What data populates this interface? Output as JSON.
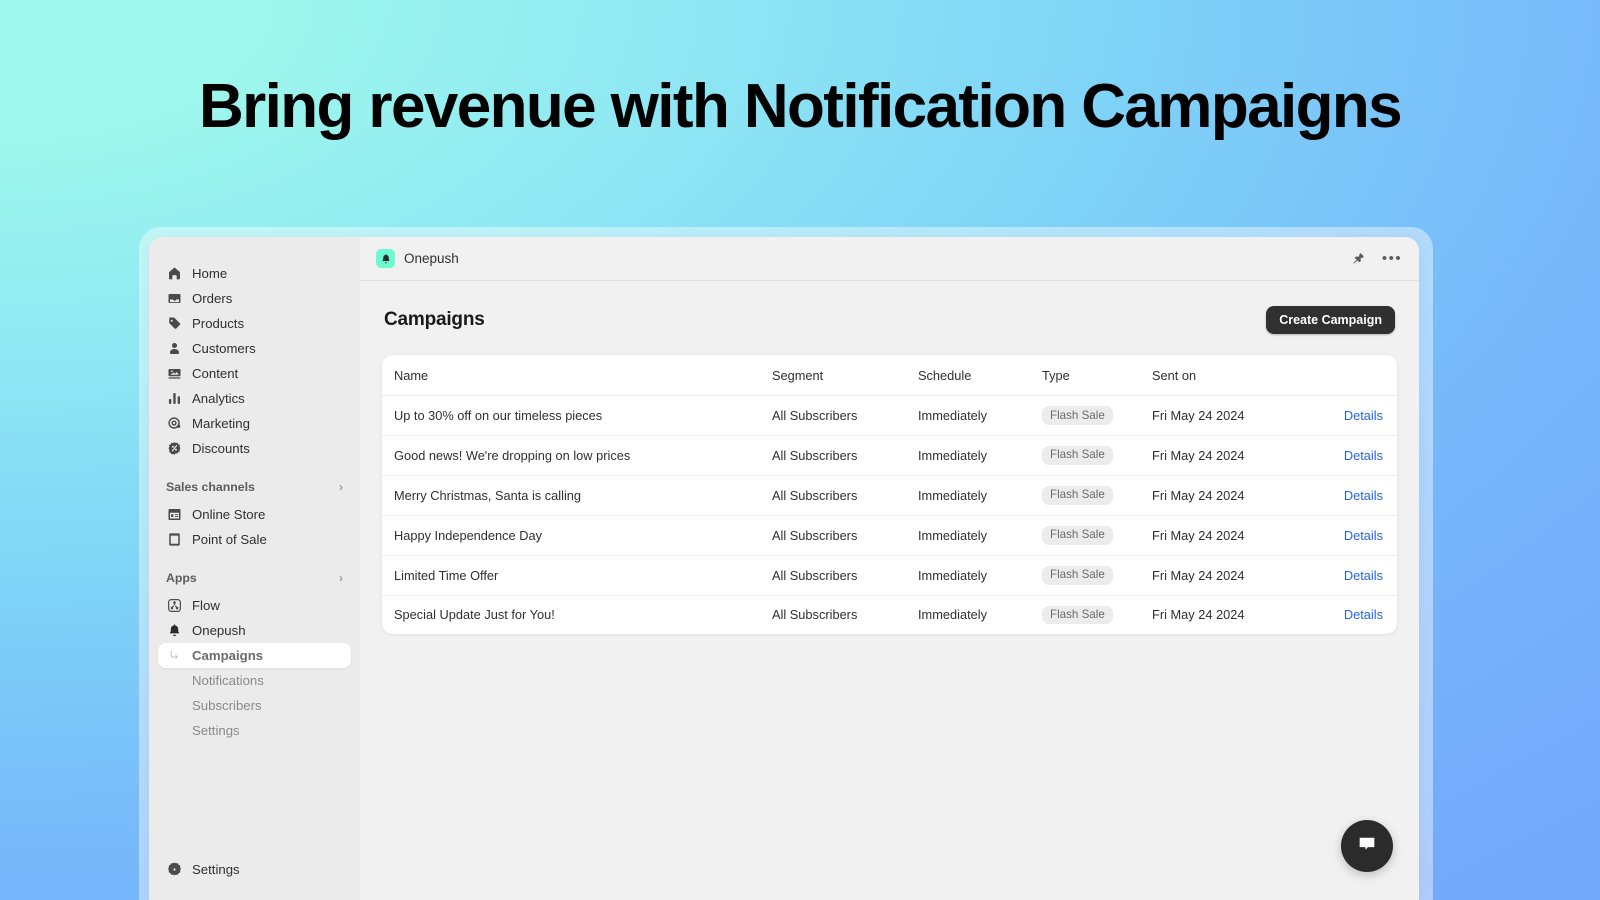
{
  "headline": "Bring revenue with Notification Campaigns",
  "colors": {
    "accent_logo": "#6efad0",
    "primary_button": "#303030",
    "link": "#2563eb",
    "badge_bg": "#ececec",
    "bg_gradient_start": "#9df7ec",
    "bg_gradient_end": "#74a8fb"
  },
  "sidebar": {
    "primary_items": [
      {
        "label": "Home",
        "icon": "home-icon"
      },
      {
        "label": "Orders",
        "icon": "orders-icon"
      },
      {
        "label": "Products",
        "icon": "products-tag-icon"
      },
      {
        "label": "Customers",
        "icon": "customers-person-icon"
      },
      {
        "label": "Content",
        "icon": "content-image-icon"
      },
      {
        "label": "Analytics",
        "icon": "analytics-bars-icon"
      },
      {
        "label": "Marketing",
        "icon": "marketing-target-icon"
      },
      {
        "label": "Discounts",
        "icon": "discounts-badge-icon"
      }
    ],
    "sales_channels": {
      "label": "Sales channels",
      "chevron": "›",
      "items": [
        {
          "label": "Online Store",
          "icon": "online-store-icon"
        },
        {
          "label": "Point of Sale",
          "icon": "point-of-sale-icon"
        }
      ]
    },
    "apps": {
      "label": "Apps",
      "chevron": "›",
      "items": [
        {
          "label": "Flow",
          "icon": "flow-icon"
        },
        {
          "label": "Onepush",
          "icon": "bell-icon"
        }
      ]
    },
    "app_subitems": [
      {
        "label": "Campaigns",
        "active": true
      },
      {
        "label": "Notifications",
        "active": false
      },
      {
        "label": "Subscribers",
        "active": false
      },
      {
        "label": "Settings",
        "active": false
      }
    ],
    "bottom": {
      "label": "Settings",
      "icon": "gear-icon"
    }
  },
  "topbar": {
    "app_name": "Onepush",
    "app_icon": "bell-icon",
    "pin_icon": "pin-icon",
    "more_icon": "ellipsis-icon"
  },
  "main": {
    "page_title": "Campaigns",
    "create_button": "Create Campaign",
    "table": {
      "columns": [
        "Name",
        "Segment",
        "Schedule",
        "Type",
        "Sent on",
        ""
      ],
      "action_label": "Details",
      "rows": [
        {
          "name": "Up to 30% off on our timeless pieces",
          "segment": "All Subscribers",
          "schedule": "Immediately",
          "type": "Flash Sale",
          "sent_on": "Fri May 24 2024",
          "action": "Details"
        },
        {
          "name": "Good news! We're dropping on low prices",
          "segment": "All Subscribers",
          "schedule": "Immediately",
          "type": "Flash Sale",
          "sent_on": "Fri May 24 2024",
          "action": "Details"
        },
        {
          "name": "Merry Christmas, Santa is calling",
          "segment": "All Subscribers",
          "schedule": "Immediately",
          "type": "Flash Sale",
          "sent_on": "Fri May 24 2024",
          "action": "Details"
        },
        {
          "name": "Happy Independence Day",
          "segment": "All Subscribers",
          "schedule": "Immediately",
          "type": "Flash Sale",
          "sent_on": "Fri May 24 2024",
          "action": "Details"
        },
        {
          "name": "Limited Time Offer",
          "segment": "All Subscribers",
          "schedule": "Immediately",
          "type": "Flash Sale",
          "sent_on": "Fri May 24 2024",
          "action": "Details"
        },
        {
          "name": "Special Update Just for You!",
          "segment": "All Subscribers",
          "schedule": "Immediately",
          "type": "Flash Sale",
          "sent_on": "Fri May 24 2024",
          "action": "Details"
        }
      ]
    },
    "chat_fab_icon": "chat-bubble-icon"
  }
}
